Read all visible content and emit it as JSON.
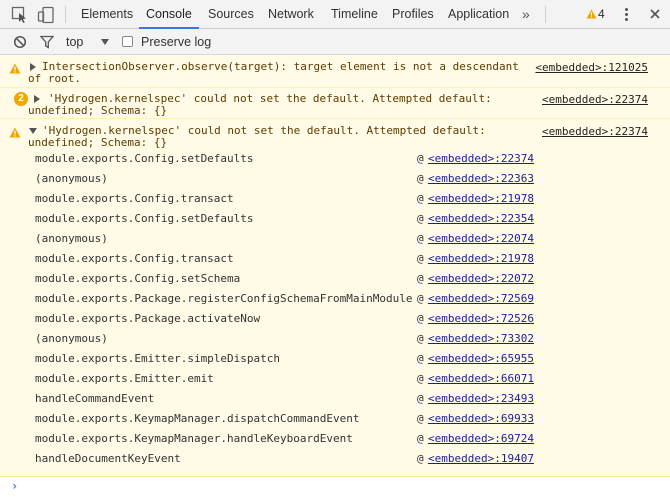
{
  "tabs": [
    "Elements",
    "Console",
    "Sources",
    "Network",
    "Timeline",
    "Profiles",
    "Application"
  ],
  "active_tab": "Console",
  "more_tabs": "»",
  "warning_count": "4",
  "toolbar": {
    "context": "top",
    "preserve_log_label": "Preserve log",
    "preserve_log_checked": false
  },
  "messages": {
    "m1": {
      "line1": "IntersectionObserver.observe(target): target element is not a descendant",
      "line2": "of root.",
      "source": "<embedded>:121025"
    },
    "m2": {
      "count": "2",
      "line1": "'Hydrogen.kernelspec' could not set the default. Attempted default:",
      "line2": "undefined; Schema: {}",
      "source": "<embedded>:22374"
    },
    "m3": {
      "line1": "'Hydrogen.kernelspec' could not set the default. Attempted default:",
      "line2": "undefined; Schema: {}",
      "source": "<embedded>:22374"
    }
  },
  "stack": [
    {
      "fn": "module.exports.Config.setDefaults",
      "at": "@",
      "src": "<embedded>:22374"
    },
    {
      "fn": "(anonymous)",
      "at": "@",
      "src": "<embedded>:22363"
    },
    {
      "fn": "module.exports.Config.transact",
      "at": "@",
      "src": "<embedded>:21978"
    },
    {
      "fn": "module.exports.Config.setDefaults",
      "at": "@",
      "src": "<embedded>:22354"
    },
    {
      "fn": "(anonymous)",
      "at": "@",
      "src": "<embedded>:22074"
    },
    {
      "fn": "module.exports.Config.transact",
      "at": "@",
      "src": "<embedded>:21978"
    },
    {
      "fn": "module.exports.Config.setSchema",
      "at": "@",
      "src": "<embedded>:22072"
    },
    {
      "fn": "module.exports.Package.registerConfigSchemaFromMainModule",
      "at": "@",
      "src": "<embedded>:72569"
    },
    {
      "fn": "module.exports.Package.activateNow",
      "at": "@",
      "src": "<embedded>:72526"
    },
    {
      "fn": "(anonymous)",
      "at": "@",
      "src": "<embedded>:73302"
    },
    {
      "fn": "module.exports.Emitter.simpleDispatch",
      "at": "@",
      "src": "<embedded>:65955"
    },
    {
      "fn": "module.exports.Emitter.emit",
      "at": "@",
      "src": "<embedded>:66071"
    },
    {
      "fn": "handleCommandEvent",
      "at": "@",
      "src": "<embedded>:23493"
    },
    {
      "fn": "module.exports.KeymapManager.dispatchCommandEvent",
      "at": "@",
      "src": "<embedded>:69933"
    },
    {
      "fn": "module.exports.KeymapManager.handleKeyboardEvent",
      "at": "@",
      "src": "<embedded>:69724"
    },
    {
      "fn": "handleDocumentKeyEvent",
      "at": "@",
      "src": "<embedded>:19407"
    }
  ],
  "prompt_symbol": "›",
  "colors": {
    "warning_bg": "#fffbe6",
    "warning_text": "#5c3c00",
    "warning_icon": "#f2a600",
    "link": "#1a1aa6",
    "active_tab": "#3879d9"
  },
  "icons": [
    "inspect-element-icon",
    "device-toolbar-icon",
    "warning-icon",
    "more-menu-icon",
    "close-icon",
    "clear-console-icon",
    "filter-icon",
    "dropdown-arrow-icon",
    "expand-triangle-icon",
    "collapse-triangle-icon",
    "console-prompt-icon"
  ]
}
